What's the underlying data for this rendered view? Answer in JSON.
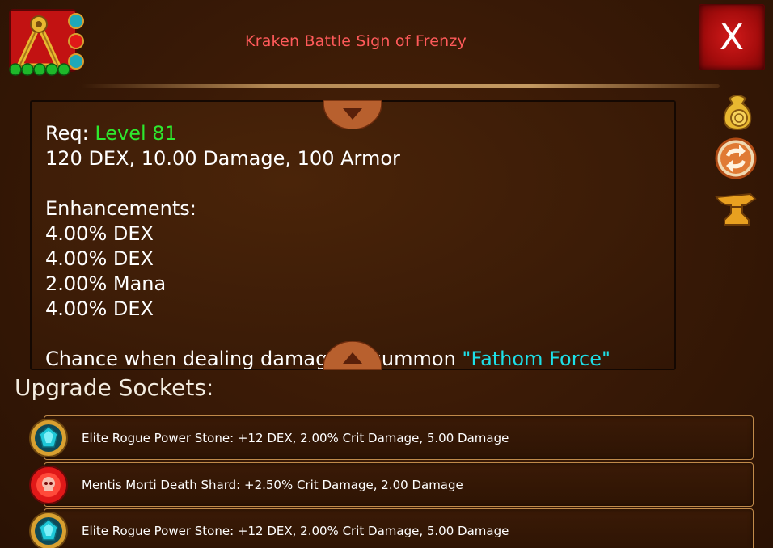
{
  "item": {
    "title": "Kraken Battle Sign of Frenzy",
    "icon": "battle-sign-triangle-icon"
  },
  "window": {
    "close_label": "X"
  },
  "description": {
    "req_label": "Req: ",
    "req_level": "Level 81",
    "stats": "120 DEX, 10.00 Damage, 100 Armor",
    "enhancements_heading": "Enhancements:",
    "enhancements": [
      "4.00% DEX",
      "4.00% DEX",
      "2.00% Mana",
      "4.00% DEX"
    ],
    "cutoff_text": "Chance when dealing damage to summon ",
    "cutoff_highlight": "\"Fathom Force\""
  },
  "side_actions": [
    {
      "name": "sell",
      "icon": "gold-coin-bag-icon"
    },
    {
      "name": "transfer",
      "icon": "swap-arrows-icon"
    },
    {
      "name": "forge",
      "icon": "anvil-icon"
    }
  ],
  "sockets": {
    "heading": "Upgrade Sockets:",
    "items": [
      {
        "label": "Elite Rogue Power Stone: +12 DEX, 2.00% Crit Damage, 5.00 Damage",
        "gem": "cyan-gem-icon",
        "color": "#1ec8d8"
      },
      {
        "label": "Mentis Morti Death Shard: +2.50% Crit Damage, 2.00 Damage",
        "gem": "red-skull-gem-icon",
        "color": "#e01818"
      },
      {
        "label": "Elite Rogue Power Stone: +12 DEX, 2.00% Crit Damage, 5.00 Damage",
        "gem": "cyan-gem-icon",
        "color": "#1ec8d8"
      }
    ]
  },
  "colors": {
    "title": "#ff5a5a",
    "level": "#2ee82e",
    "highlight": "#1de0e8",
    "close_bg": "#b81010"
  }
}
